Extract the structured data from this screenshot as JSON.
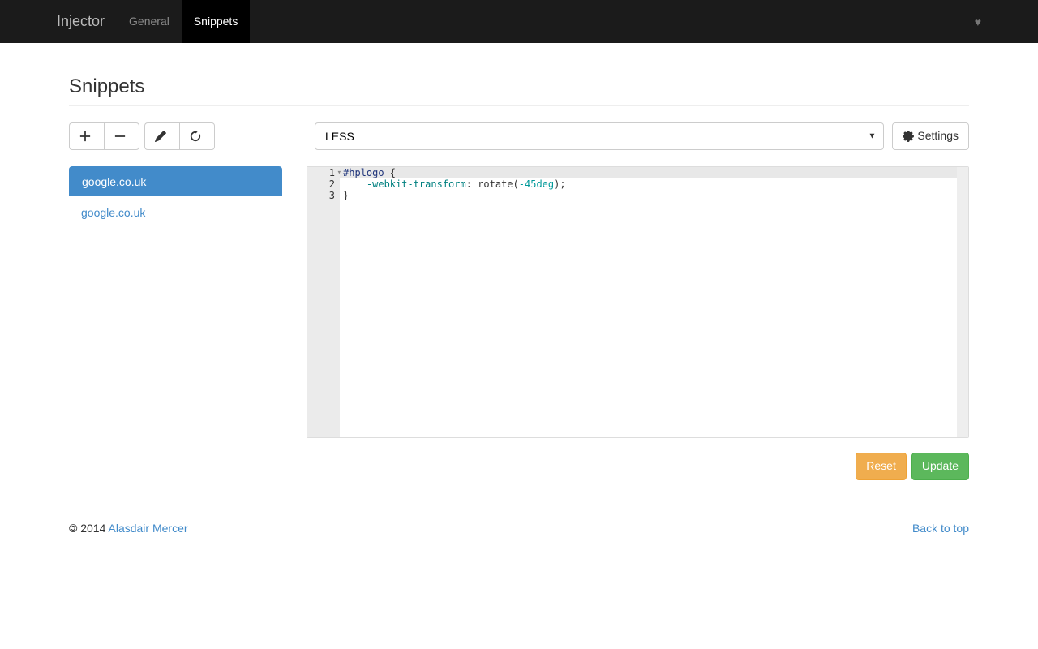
{
  "nav": {
    "brand": "Injector",
    "tabs": [
      {
        "label": "General",
        "active": false
      },
      {
        "label": "Snippets",
        "active": true
      }
    ]
  },
  "page_title": "Snippets",
  "toolbar": {
    "add_title": "Add",
    "remove_title": "Remove",
    "edit_title": "Edit",
    "clone_title": "Clone",
    "settings_label": "Settings"
  },
  "mode_select": {
    "value": "LESS"
  },
  "snippets": [
    {
      "label": "google.co.uk",
      "active": true
    },
    {
      "label": "google.co.uk",
      "active": false
    }
  ],
  "editor": {
    "lines": [
      "1",
      "2",
      "3"
    ],
    "code": {
      "l1_selector": "#hplogo",
      "l1_brace": " {",
      "l2_indent": "    ",
      "l2_prop": "-webkit-transform",
      "l2_colon": ": rotate(",
      "l2_val": "-45deg",
      "l2_end": ");",
      "l3": "}"
    }
  },
  "actions": {
    "reset": "Reset",
    "update": "Update"
  },
  "footer": {
    "year": "2014",
    "author": "Alasdair Mercer",
    "back_to_top": "Back to top"
  }
}
